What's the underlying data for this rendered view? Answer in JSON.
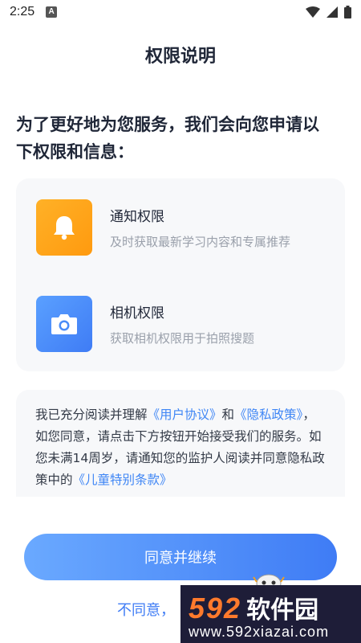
{
  "status_bar": {
    "time": "2:25",
    "app_icon_letter": "A",
    "icons": [
      "wifi-icon",
      "signal-icon",
      "battery-icon"
    ]
  },
  "page": {
    "title": "权限说明",
    "intro_line1": "为了更好地为您服务，我们会向您申请以",
    "intro_line2": "下权限和信息："
  },
  "permissions": [
    {
      "icon": "bell-icon",
      "title": "通知权限",
      "desc": "及时获取最新学习内容和专属推荐",
      "color": "#ffa51b"
    },
    {
      "icon": "camera-icon",
      "title": "相机权限",
      "desc": "获取相机权限用于拍照搜题",
      "color": "#4a8cf8"
    }
  ],
  "policy": {
    "t1": "我已充分阅读并理解",
    "user_agreement": "《用户协议》",
    "and": "和",
    "privacy_policy": "《隐私政策》",
    "t2": "，如您同意，请点击下方按钮开始接受我们的服务。如您未满14周岁，请通知您的监护人阅读并同意隐私政策中的",
    "children_terms": "《儿童特别条款》"
  },
  "buttons": {
    "agree": "同意并继续",
    "disagree": "不同意，"
  },
  "watermark": {
    "number": "592",
    "brand": "软件园",
    "url": "www.592xiazai.com"
  },
  "colors": {
    "accent": "#3f7cf5",
    "link": "#3f86f5",
    "orange": "#ffa51b",
    "watermark_bg": "#1e1d38",
    "watermark_orange": "#ff7a2c"
  }
}
